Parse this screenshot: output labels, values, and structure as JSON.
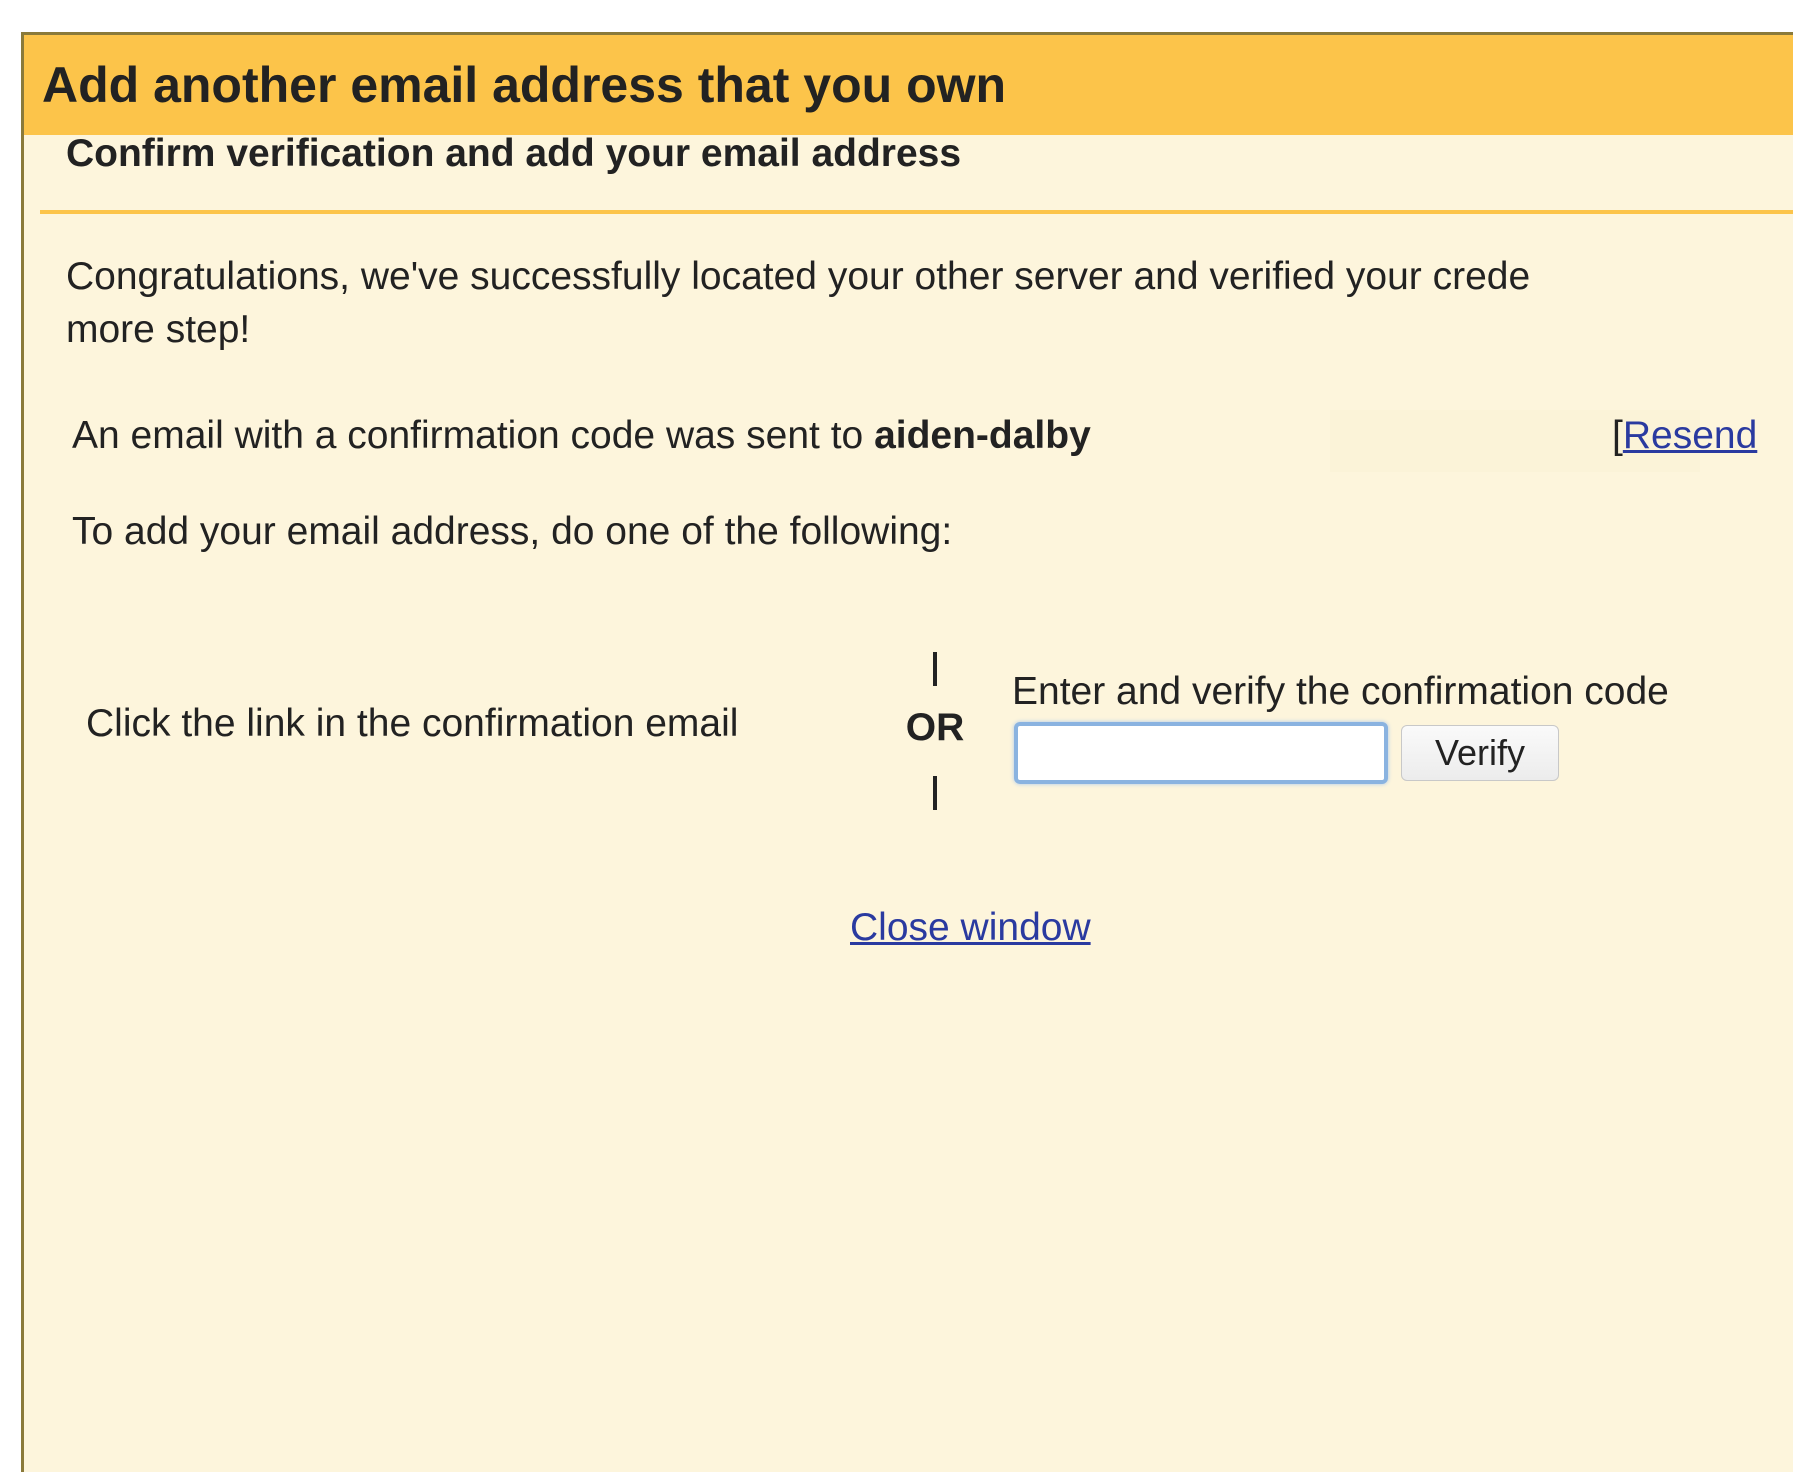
{
  "dialog": {
    "title": "Add another email address that you own",
    "subtitle": "Confirm verification and add your email address",
    "congrats_line1": "Congratulations, we've successfully located your other server and verified your crede",
    "congrats_line2": "more step!",
    "sent_prefix": "An email with a confirmation code was sent to ",
    "sent_email": "aiden-dalby",
    "resend_bracket": "[",
    "resend_label": "Resend",
    "instruction": "To add your email address, do one of the following:",
    "option_link_text": "Click the link in the confirmation email",
    "or_label": "OR",
    "option_code_text": "Enter and verify the confirmation code",
    "code_input_value": "",
    "verify_label": "Verify",
    "close_label": "Close window"
  },
  "colors": {
    "title_bar": "#fcc44a",
    "background": "#fdf5dc",
    "link": "#2a3aa0",
    "input_focus_border": "#8ab3e0"
  }
}
